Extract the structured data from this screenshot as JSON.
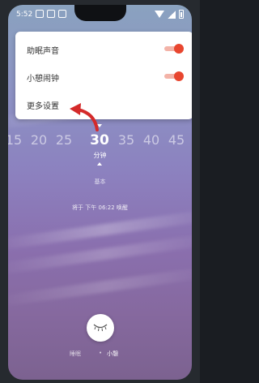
{
  "status_bar": {
    "time": "5:52"
  },
  "menu": {
    "items": [
      {
        "label": "助眠声音",
        "toggle_on": true
      },
      {
        "label": "小憩闹钟",
        "toggle_on": true
      },
      {
        "label": "更多设置"
      }
    ]
  },
  "picker": {
    "values": [
      "15",
      "20",
      "25",
      "30",
      "35",
      "40",
      "45"
    ],
    "selected": "30",
    "unit": "分钟"
  },
  "mode_label": "基本",
  "wake_text": "将于 下午 06:22 唤醒",
  "bottom_tabs": {
    "sleep": "睡眠",
    "separator": "•",
    "nap": "小憩"
  },
  "colors": {
    "accent": "#e8462f",
    "annotation_arrow": "#d42a2a"
  },
  "icons": {
    "start_button": "closed-eye-icon",
    "arrow": "red-curved-arrow-icon"
  }
}
